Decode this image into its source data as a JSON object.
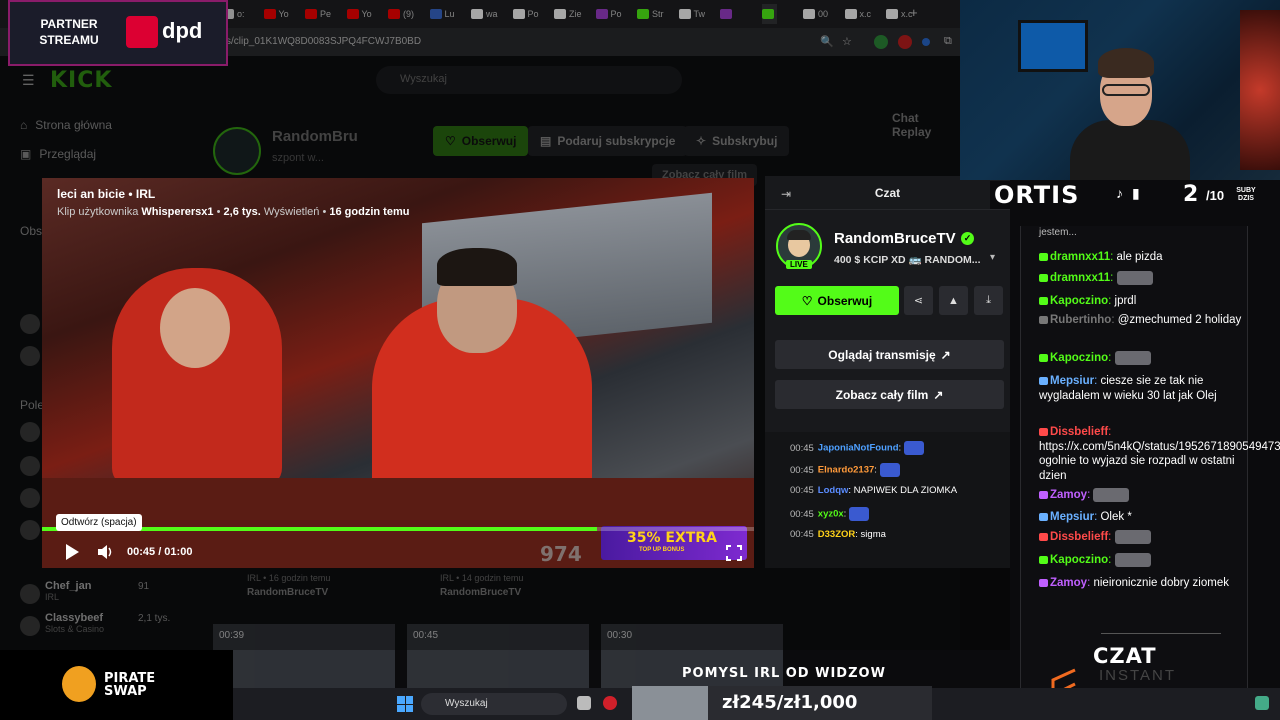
{
  "browser": {
    "tabs": [
      "o:",
      "Yo",
      "Pe",
      "Yo",
      "(9)",
      "Lu",
      "wa",
      "Po",
      "Zie",
      "Po",
      "Str",
      "Tw",
      "",
      "",
      "00",
      "x.c",
      "x.c"
    ],
    "url": "s/clip_01K1WQ8D0083SJPQ4FCWJ7B0BD"
  },
  "kick": {
    "logo": "KICK",
    "search_placeholder": "Wyszukaj",
    "nav": [
      "Strona główna",
      "Przeglądaj"
    ],
    "section_followed": "Obse",
    "section_recommended": "Polec",
    "side_channels": [
      {
        "name": "Chef_jan",
        "category": "IRL",
        "viewers": "91"
      },
      {
        "name": "Classybeef",
        "category": "Slots & Casino",
        "viewers": "2,1 tys."
      }
    ],
    "streamer_name": "RandomBru",
    "streamer_sub": "szpont w...",
    "follow_bg": "Obserwuj",
    "gift_sub": "Podaruj subskrypcje",
    "subscribe": "Subskrybuj",
    "see_full": "Zobacz cały film",
    "chat_replay": "Chat Replay"
  },
  "clip": {
    "title": "leci an bicie • IRL",
    "meta_prefix": "Klip użytkownika",
    "author": "Whisperersx1",
    "views": "2,6 tys.",
    "views_label": "Wyświetleń",
    "age": "16 godzin temu",
    "tooltip": "Odtwórz (spacja)",
    "time": "00:45 / 01:00",
    "progress": 0.78,
    "banner_main": "35% EXTRA",
    "banner_sub": "TOP UP BONUS",
    "overlay_count": "974"
  },
  "chat_panel": {
    "title": "Czat",
    "channel": "RandomBruceTV",
    "live": "LIVE",
    "subtitle": "400 $ KCIP XD 🚌 RANDOM...",
    "follow": "Obserwuj",
    "watch_stream": "Oglądaj transmisję",
    "watch_film": "Zobacz cały film",
    "messages": [
      {
        "ts": "00:45",
        "user": "JaponiaNotFound",
        "color": "#4ea0ff",
        "text": ""
      },
      {
        "ts": "00:45",
        "user": "Elnardo2137",
        "color": "#ff9a3a",
        "text": ""
      },
      {
        "ts": "00:45",
        "user": "Lodqw",
        "color": "#5a8cff",
        "text": "NAPIWEK DLA ZIOMKA"
      },
      {
        "ts": "00:45",
        "user": "xyz0x",
        "color": "#53fc18",
        "text": ""
      },
      {
        "ts": "00:45",
        "user": "D33ZOR",
        "color": "#ffd21a",
        "text": "sigma"
      }
    ]
  },
  "overlay": {
    "partner": "PARTNER STREAMU",
    "dpd": "dpd",
    "ortis": "ORTIS",
    "subs_count": "2",
    "subs_goal": "/10",
    "subs_label": "SUBY DZIS",
    "pirate": "PIRATE SWAP",
    "idea": "POMYSL IRL OD WIDZOW",
    "donation": "zł245/zł1,000",
    "czat_logo": "CZAT",
    "czat_instant": "INSTANT GAMING"
  },
  "stream_chat": [
    {
      "user": "",
      "color": "#ddd",
      "text": "jestem..."
    },
    {
      "user": "dramnxx11",
      "color": "#53fc18",
      "text": "ale pizda"
    },
    {
      "user": "dramnxx11",
      "color": "#53fc18",
      "text": ""
    },
    {
      "user": "Kapoczino",
      "color": "#53fc18",
      "text": "jprdl"
    },
    {
      "user": "Rubertinho",
      "color": "#777",
      "text": "@zmechumed 2 holiday"
    },
    {
      "user": "Kapoczino",
      "color": "#53fc18",
      "text": ""
    },
    {
      "user": "Mepsiur",
      "color": "#6ab0ff",
      "text": "ciesze sie ze tak nie wygladalem w wieku 30 lat jak Olej"
    },
    {
      "user": "Dissbelieff",
      "color": "#ff4a4a",
      "text": "https://x.com/5n4kQ/status/1952671890549473508 ogolnie to wyjazd sie rozpadl w ostatni dzien"
    },
    {
      "user": "Zamoy",
      "color": "#c060ff",
      "text": ""
    },
    {
      "user": "Mepsiur",
      "color": "#6ab0ff",
      "text": "Olek *"
    },
    {
      "user": "Dissbelieff",
      "color": "#ff4a4a",
      "text": ""
    },
    {
      "user": "Kapoczino",
      "color": "#53fc18",
      "text": ""
    },
    {
      "user": "Zamoy",
      "color": "#c060ff",
      "text": "nieironicznie dobry ziomek"
    }
  ],
  "taskbar": {
    "search": "Wyszukaj"
  },
  "thumbs": [
    {
      "duration": "00:39"
    },
    {
      "duration": "00:45"
    },
    {
      "duration": "00:30"
    }
  ],
  "bg_clips": [
    {
      "meta": "IRL • 16 godzin temu",
      "channel": "RandomBruceTV"
    },
    {
      "meta": "IRL • 14 godzin temu",
      "channel": "RandomBruceTV"
    }
  ]
}
